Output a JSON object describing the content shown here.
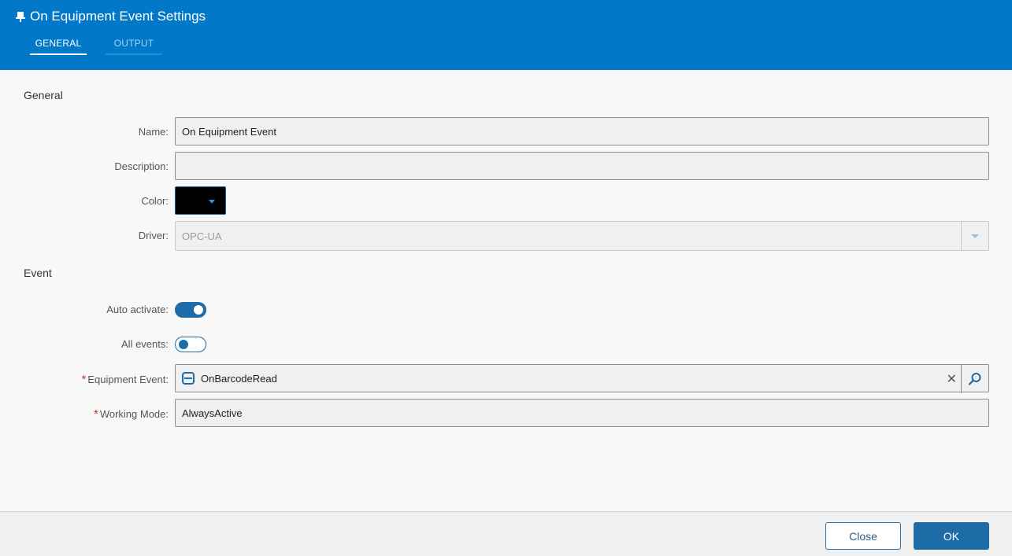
{
  "header": {
    "title": "On Equipment Event Settings",
    "title_icon": "pin-icon",
    "tabs": [
      {
        "label": "GENERAL",
        "active": true
      },
      {
        "label": "OUTPUT",
        "active": false
      }
    ],
    "color": "#0178c8"
  },
  "general": {
    "section_title": "General",
    "name": {
      "label": "Name:",
      "value": "On Equipment Event"
    },
    "description": {
      "label": "Description:",
      "value": ""
    },
    "color": {
      "label": "Color:",
      "value": "#000000"
    },
    "driver": {
      "label": "Driver:",
      "value": "OPC-UA"
    }
  },
  "event": {
    "section_title": "Event",
    "auto_activate": {
      "label": "Auto activate:",
      "on": true
    },
    "all_events": {
      "label": "All events:",
      "on": false
    },
    "equipment_event": {
      "label": "Equipment Event:",
      "required": "*",
      "value": "OnBarcodeRead",
      "icon": "event-icon"
    },
    "working_mode": {
      "label": "Working Mode:",
      "required": "*",
      "value": "AlwaysActive"
    }
  },
  "footer": {
    "close_label": "Close",
    "ok_label": "OK"
  }
}
